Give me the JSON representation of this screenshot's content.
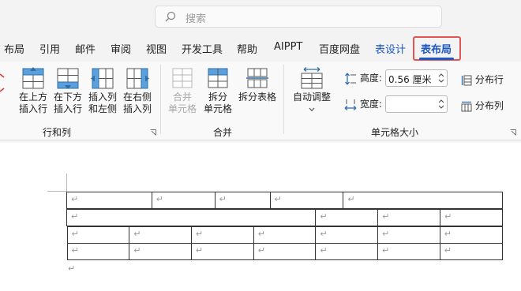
{
  "search": {
    "placeholder": "搜索"
  },
  "tabs": [
    {
      "label": "布局"
    },
    {
      "label": "引用"
    },
    {
      "label": "邮件"
    },
    {
      "label": "审阅"
    },
    {
      "label": "视图"
    },
    {
      "label": "开发工具"
    },
    {
      "label": "帮助"
    },
    {
      "label": "AIPPT"
    },
    {
      "label": "百度网盘"
    },
    {
      "label": "表设计"
    },
    {
      "label": "表布局"
    }
  ],
  "ribbon": {
    "rows_cols": {
      "insert_above": [
        "在上方",
        "插入行"
      ],
      "insert_below": [
        "在下方",
        "插入行"
      ],
      "insert_left": [
        "插入列",
        "和左侧"
      ],
      "insert_right": [
        "在右侧",
        "插入列"
      ],
      "group_label": "行和列"
    },
    "merge": {
      "merge_cells": [
        "合并",
        "单元格"
      ],
      "split_cells": [
        "拆分",
        "单元格"
      ],
      "split_table": "拆分表格",
      "group_label": "合并"
    },
    "cell_size": {
      "autofit": "自动调整",
      "height_label": "高度:",
      "height_value": "0.56 厘米",
      "width_label": "宽度:",
      "width_value": "",
      "distribute_rows": "分布行",
      "distribute_cols": "分布列",
      "group_label": "单元格大小"
    }
  },
  "document": {
    "paragraph_mark": "↵"
  },
  "colors": {
    "accent": "#1f58c5",
    "highlight_box": "#e05555",
    "ribbon_bg": "#f9f9f9",
    "titlebar_bg": "#f3f3f3"
  }
}
